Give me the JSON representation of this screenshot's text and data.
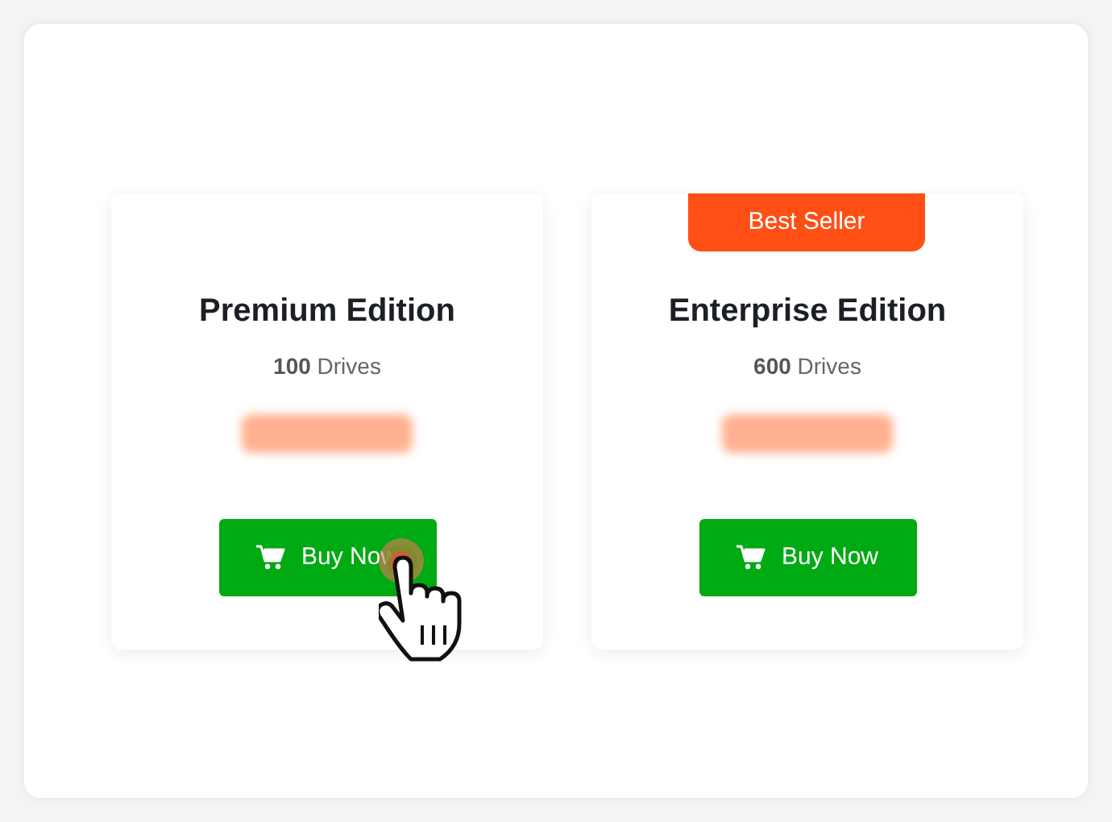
{
  "plans": [
    {
      "title": "Premium Edition",
      "count": "100",
      "unit": "Drives",
      "button": "Buy Now",
      "cursor": true
    },
    {
      "badge": "Best Seller",
      "title": "Enterprise Edition",
      "count": "600",
      "unit": "Drives",
      "button": "Buy Now",
      "cursor": false
    }
  ]
}
